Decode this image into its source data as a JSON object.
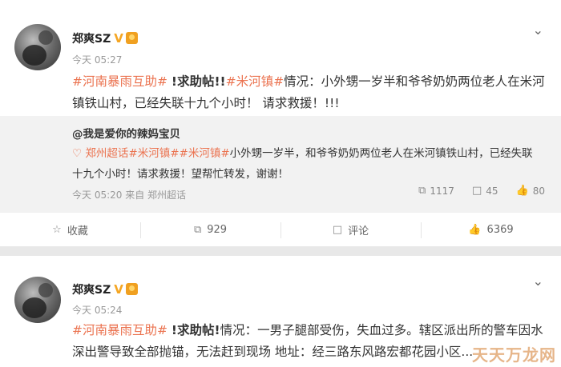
{
  "post1": {
    "author": "郑爽SZ",
    "verified_badge": "V",
    "time": "今天 05:27",
    "tag1": "#河南暴雨互助#",
    "sep1": " ",
    "help1": "!求助帖!!",
    "tag2": "#米河镇#",
    "body": "情况：小外甥一岁半和爷爷奶奶两位老人在米河镇铁山村，已经失联十九个小时！ 请求救援！!!!",
    "quote": {
      "name": "@我是爱你的辣妈宝贝",
      "tags": "郑州超话#米河镇##米河镇#",
      "text": "小外甥一岁半，和爷爷奶奶两位老人在米河镇铁山村，已经失联十九个小时！请求救援！望帮忙转发，谢谢！",
      "meta": "今天 05:20 来自 郑州超话",
      "share_count": "1117",
      "comment_count": "45",
      "like_count": "80"
    },
    "actions": {
      "collect": "收藏",
      "share": "929",
      "comment": "评论",
      "like": "6369"
    }
  },
  "post2": {
    "author": "郑爽SZ",
    "verified_badge": "V",
    "time": "今天 05:24",
    "tag1": "#河南暴雨互助#",
    "help1": "!求助帖!",
    "body": "情况：一男子腿部受伤，失血过多。辖区派出所的警车因水深出警导致全部抛锚，无法赶到现场 地址：经三路东风路宏都花园小区..."
  },
  "watermark": "天天万龙网",
  "colors": {
    "tag": "#eb7350",
    "vbadge": "#f5a623",
    "background": "#e8e8e8"
  }
}
